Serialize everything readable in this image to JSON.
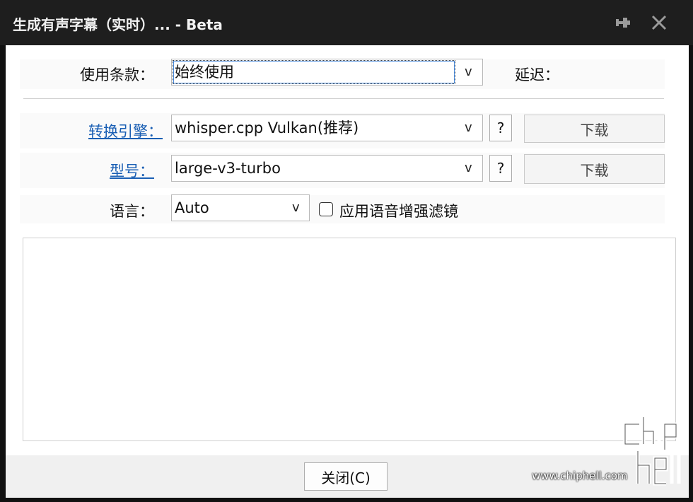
{
  "window": {
    "title": "生成有声字幕（实时）... - Beta",
    "pin_icon": "pin-icon",
    "close_icon": "close-icon"
  },
  "terms": {
    "label": "使用条款：",
    "value": "始终使用",
    "arrow": "v",
    "delay_label": "延迟："
  },
  "engine": {
    "label": "转换引擎：",
    "value": "whisper.cpp Vulkan(推荐)",
    "arrow": "v",
    "help": "?",
    "download": "下载"
  },
  "model": {
    "label": "型号：",
    "value": "large-v3-turbo",
    "arrow": "v",
    "help": "?",
    "download": "下载"
  },
  "language": {
    "label": "语言：",
    "value": "Auto",
    "arrow": "v",
    "filter_label": "应用语音增强滤镜",
    "filter_checked": false
  },
  "output": {
    "text": ""
  },
  "footer": {
    "close_label": "关闭(C)"
  },
  "watermark": {
    "logo_text": "chip hell",
    "url": "www.chiphell.com"
  },
  "colors": {
    "titlebar": "#1e1e1e",
    "link": "#1a5fb4"
  }
}
